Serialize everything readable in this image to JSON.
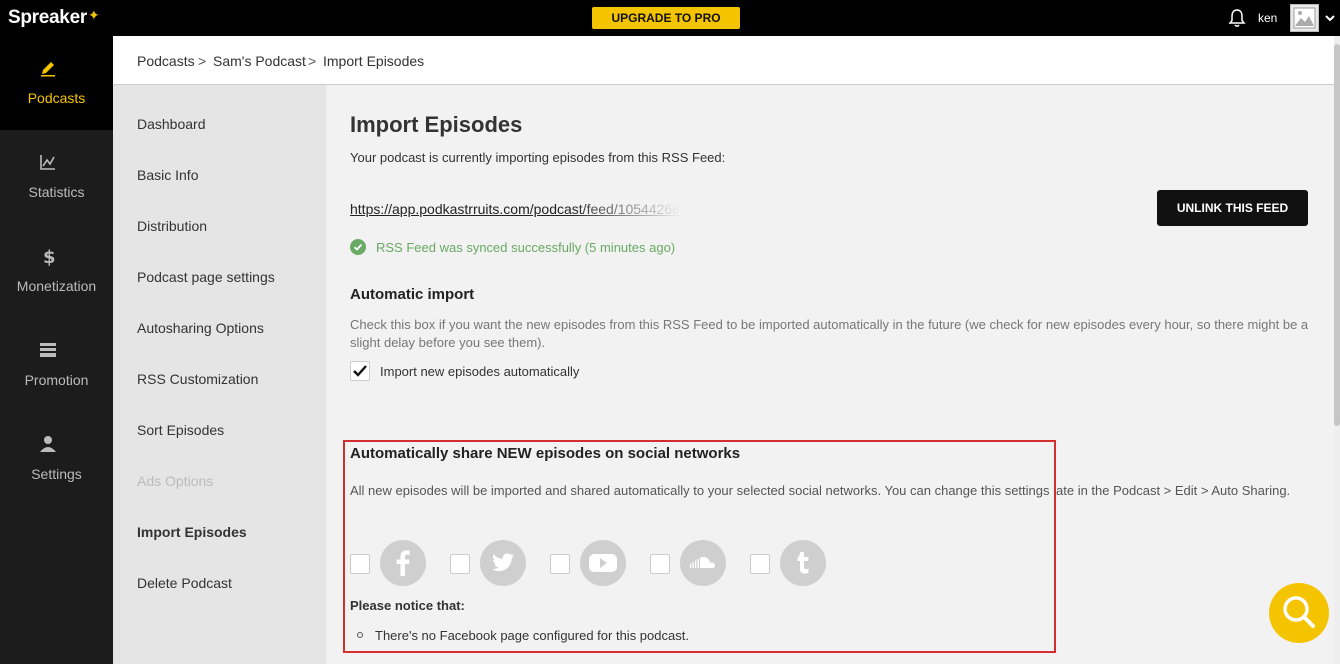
{
  "topbar": {
    "logo": "Spreaker",
    "upgrade_label": "UPGRADE TO PRO",
    "username": "ken"
  },
  "leftnav": [
    {
      "label": "Podcasts",
      "icon": "pencil-icon",
      "active": true
    },
    {
      "label": "Statistics",
      "icon": "chart-icon",
      "active": false
    },
    {
      "label": "Monetization",
      "icon": "dollar-icon",
      "active": false
    },
    {
      "label": "Promotion",
      "icon": "promotion-icon",
      "active": false
    },
    {
      "label": "Settings",
      "icon": "user-icon",
      "active": false
    }
  ],
  "breadcrumb": [
    "Podcasts",
    "Sam's Podcast",
    "Import Episodes"
  ],
  "subnav": [
    {
      "label": "Dashboard",
      "state": "normal"
    },
    {
      "label": "Basic Info",
      "state": "normal"
    },
    {
      "label": "Distribution",
      "state": "normal"
    },
    {
      "label": "Podcast page settings",
      "state": "normal"
    },
    {
      "label": "Autosharing Options",
      "state": "normal"
    },
    {
      "label": "RSS Customization",
      "state": "normal"
    },
    {
      "label": "Sort Episodes",
      "state": "normal"
    },
    {
      "label": "Ads Options",
      "state": "disabled"
    },
    {
      "label": "Import Episodes",
      "state": "active"
    },
    {
      "label": "Delete Podcast",
      "state": "normal"
    }
  ],
  "main": {
    "title": "Import Episodes",
    "subtitle": "Your podcast is currently importing episodes from this RSS Feed:",
    "feed_url": "https://app.podkastrruits.com/podcast/feed/105442682",
    "unlink_label": "UNLINK THIS FEED",
    "sync_status": "RSS Feed was synced successfully (5 minutes ago)",
    "auto_import": {
      "heading": "Automatic import",
      "description": "Check this box if you want the new episodes from this RSS Feed to be imported automatically in the future (we check for new episodes every hour, so there might be a slight delay before you see them).",
      "checkbox_label": "Import new episodes automatically",
      "checked": true
    },
    "share": {
      "heading": "Automatically share NEW episodes on social networks",
      "description": "All new episodes will be imported and shared automatically to your selected social networks. You can change this settings late in the Podcast > Edit > Auto Sharing.",
      "networks": [
        {
          "icon": "facebook-icon",
          "checked": false
        },
        {
          "icon": "twitter-icon",
          "checked": false
        },
        {
          "icon": "youtube-icon",
          "checked": false
        },
        {
          "icon": "soundcloud-icon",
          "checked": false
        },
        {
          "icon": "tumblr-icon",
          "checked": false
        }
      ],
      "notice_heading": "Please notice that:",
      "notice_items": [
        "There's no Facebook page configured for this podcast."
      ]
    }
  },
  "colors": {
    "accent": "#f5c400",
    "success": "#6aaa64",
    "highlight_border": "#d32f2f"
  }
}
